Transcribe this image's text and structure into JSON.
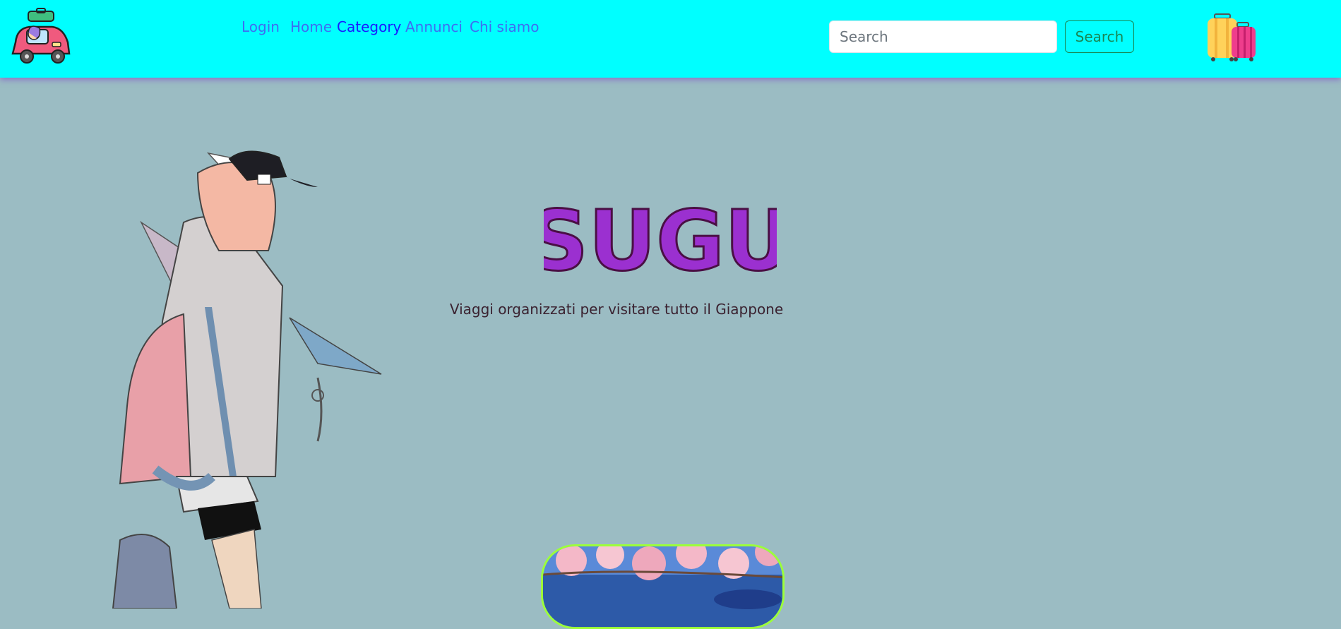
{
  "nav": {
    "logo_icon": "car-with-girl-logo",
    "links": [
      {
        "label": "Login"
      },
      {
        "label": "Home"
      },
      {
        "label": "Category"
      },
      {
        "label": "Annunci"
      },
      {
        "label": "Chi siamo"
      }
    ],
    "search_placeholder": "Search",
    "search_value": "",
    "search_button_label": "Search",
    "cart_icon": "luggage-icon",
    "colors": {
      "navbar_bg": "#00ffff",
      "link": "#3e6df2",
      "active_link": "#1a1aff",
      "search_button": "#198754"
    }
  },
  "hero": {
    "title": "SUGU",
    "tagline": "Viaggi organizzati per visitare tutto il Giappone",
    "title_color": "#9b30d0",
    "illustration": "anime-girl-with-backpack",
    "photo": "cherry-blossom-photo"
  },
  "page": {
    "background": "#9bbcc3"
  }
}
